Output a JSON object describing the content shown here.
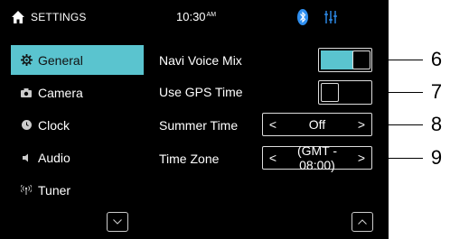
{
  "status": {
    "title": "SETTINGS",
    "time": "10:30",
    "ampm": "AM"
  },
  "sidebar": {
    "items": [
      {
        "label": "General",
        "icon": "gear-icon",
        "active": true
      },
      {
        "label": "Camera",
        "icon": "camera-icon"
      },
      {
        "label": "Clock",
        "icon": "clock-icon"
      },
      {
        "label": "Audio",
        "icon": "speaker-icon"
      },
      {
        "label": "Tuner",
        "icon": "antenna-icon"
      }
    ]
  },
  "settings": {
    "navi_voice_mix": {
      "label": "Navi Voice Mix",
      "on": true
    },
    "use_gps_time": {
      "label": "Use GPS Time",
      "on": false
    },
    "summer_time": {
      "label": "Summer Time",
      "value": "Off"
    },
    "time_zone": {
      "label": "Time Zone",
      "value": "(GMT - 08:00)"
    }
  },
  "callouts": [
    "6",
    "7",
    "8",
    "9"
  ],
  "colors": {
    "accent": "#5ac4cf",
    "background": "#000000"
  }
}
